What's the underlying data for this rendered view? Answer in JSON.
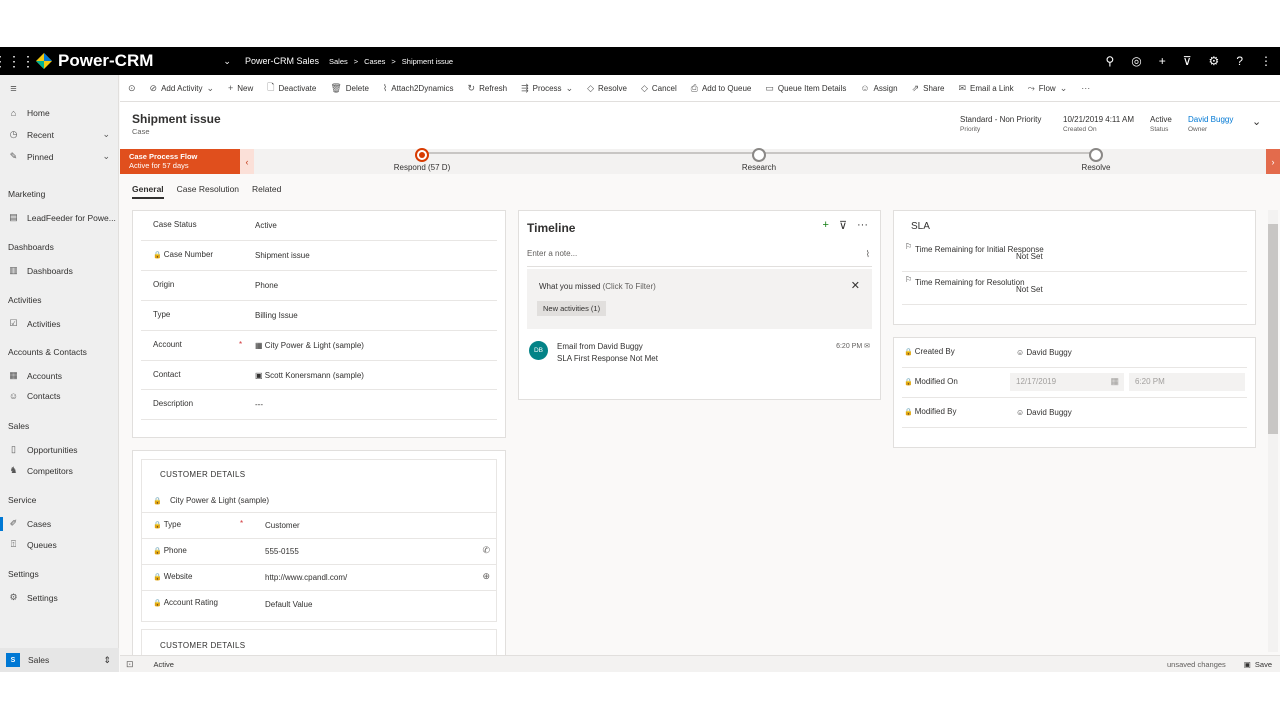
{
  "topnav": {
    "app_name": "Power-CRM",
    "app_selector": "Power-CRM Sales",
    "breadcrumb": [
      "Sales",
      "Cases",
      "Shipment issue"
    ]
  },
  "sidebar": {
    "items": [
      {
        "label": "Home",
        "icon": "home-icon"
      },
      {
        "label": "Recent",
        "icon": "clock-icon"
      },
      {
        "label": "Pinned",
        "icon": "pin-icon"
      }
    ],
    "groups": [
      {
        "title": "Marketing",
        "items": [
          "LeadFeeder for Powe..."
        ]
      },
      {
        "title": "Dashboards",
        "items": [
          "Dashboards"
        ]
      },
      {
        "title": "Activities",
        "items": [
          "Activities"
        ]
      },
      {
        "title": "Accounts & Contacts",
        "items": [
          "Accounts",
          "Contacts"
        ]
      },
      {
        "title": "Sales",
        "items": [
          "Opportunities",
          "Competitors"
        ]
      },
      {
        "title": "Service",
        "items": [
          "Cases",
          "Queues"
        ]
      },
      {
        "title": "Settings",
        "items": [
          "Settings"
        ]
      }
    ],
    "area": {
      "badge": "S",
      "label": "Sales"
    }
  },
  "commands": [
    "Add Activity",
    "New",
    "Deactivate",
    "Delete",
    "Attach2Dynamics",
    "Refresh",
    "Process",
    "Resolve",
    "Cancel",
    "Add to Queue",
    "Queue Item Details",
    "Assign",
    "Share",
    "Email a Link",
    "Flow"
  ],
  "header": {
    "title": "Shipment issue",
    "entity": "Case",
    "priority": {
      "value": "Standard - Non Priority",
      "label": "Priority"
    },
    "created_on": {
      "value": "10/21/2019 4:11 AM",
      "label": "Created On"
    },
    "status": {
      "value": "Active",
      "label": "Status"
    },
    "owner": {
      "value": "David Buggy",
      "label": "Owner"
    }
  },
  "bpf": {
    "flow_name": "Case Process Flow",
    "active_for": "Active for 57 days",
    "stages": [
      "Respond  (57 D)",
      "Research",
      "Resolve"
    ]
  },
  "tabs": [
    "General",
    "Case Resolution",
    "Related"
  ],
  "general": {
    "fields": [
      {
        "label": "Case Status",
        "value": "Active"
      },
      {
        "label": "Case Number",
        "value": "Shipment issue"
      },
      {
        "label": "Origin",
        "value": "Phone"
      },
      {
        "label": "Type",
        "value": "Billing Issue"
      },
      {
        "label": "Account",
        "value": "City Power & Light (sample)"
      },
      {
        "label": "Contact",
        "value": "Scott Konersmann (sample)"
      },
      {
        "label": "Description",
        "value": "---"
      }
    ]
  },
  "customer_details": {
    "heading": "CUSTOMER DETAILS",
    "account_name": "City Power & Light (sample)",
    "fields": [
      {
        "label": "Type",
        "value": "Customer"
      },
      {
        "label": "Phone",
        "value": "555-0155"
      },
      {
        "label": "Website",
        "value": "http://www.cpandl.com/"
      },
      {
        "label": "Account Rating",
        "value": "Default Value"
      }
    ],
    "heading2": "CUSTOMER DETAILS"
  },
  "timeline": {
    "title": "Timeline",
    "note_placeholder": "Enter a note...",
    "missed_title": "What you missed",
    "missed_hint": "(Click To Filter)",
    "new_activities": "New activities (1)",
    "item": {
      "avatar": "DB",
      "title": "Email from David Buggy",
      "subtitle": "SLA First Response Not Met",
      "time": "6:20 PM"
    }
  },
  "sla": {
    "title": "SLA",
    "fields": [
      {
        "label": "Time Remaining for Initial Response",
        "value": "Not Set"
      },
      {
        "label": "Time Remaining for Resolution",
        "value": "Not Set"
      }
    ]
  },
  "audit": {
    "created_by": {
      "label": "Created By",
      "value": "David Buggy"
    },
    "modified_on": {
      "label": "Modified On",
      "date": "12/17/2019",
      "time": "6:20 PM"
    },
    "modified_by": {
      "label": "Modified By",
      "value": "David Buggy"
    }
  },
  "statusbar": {
    "status": "Active",
    "unsaved": "unsaved changes",
    "save": "Save"
  }
}
